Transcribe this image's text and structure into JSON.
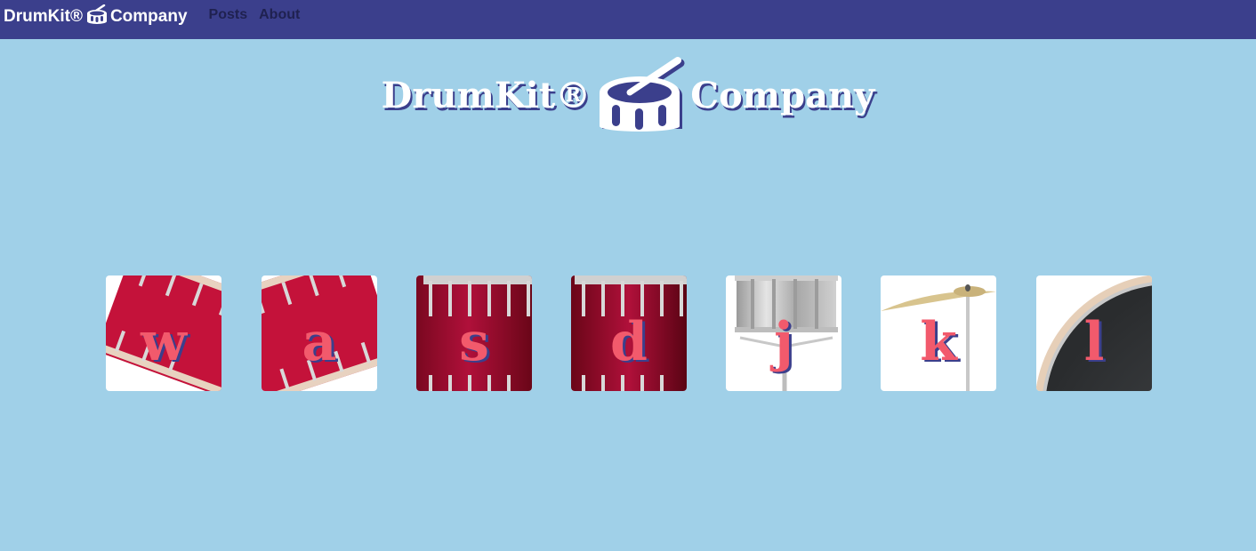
{
  "nav": {
    "brand_left": "DrumKit®",
    "brand_right": "Company",
    "brand_icon": "drum-icon",
    "links": [
      "Posts",
      "About"
    ]
  },
  "hero": {
    "left": "DrumKit®",
    "right": "Company",
    "icon": "drum-icon"
  },
  "keys": [
    {
      "letter": "w",
      "instrument": "tom-drum"
    },
    {
      "letter": "a",
      "instrument": "tom-drum"
    },
    {
      "letter": "s",
      "instrument": "floor-tom"
    },
    {
      "letter": "d",
      "instrument": "floor-tom"
    },
    {
      "letter": "j",
      "instrument": "snare-drum"
    },
    {
      "letter": "k",
      "instrument": "cymbal"
    },
    {
      "letter": "l",
      "instrument": "bass-drum"
    }
  ],
  "colors": {
    "navbar": "#3b3f8c",
    "background": "#a0d0e8",
    "letter": "#f25a6c",
    "drum_red": "#c4123a"
  }
}
